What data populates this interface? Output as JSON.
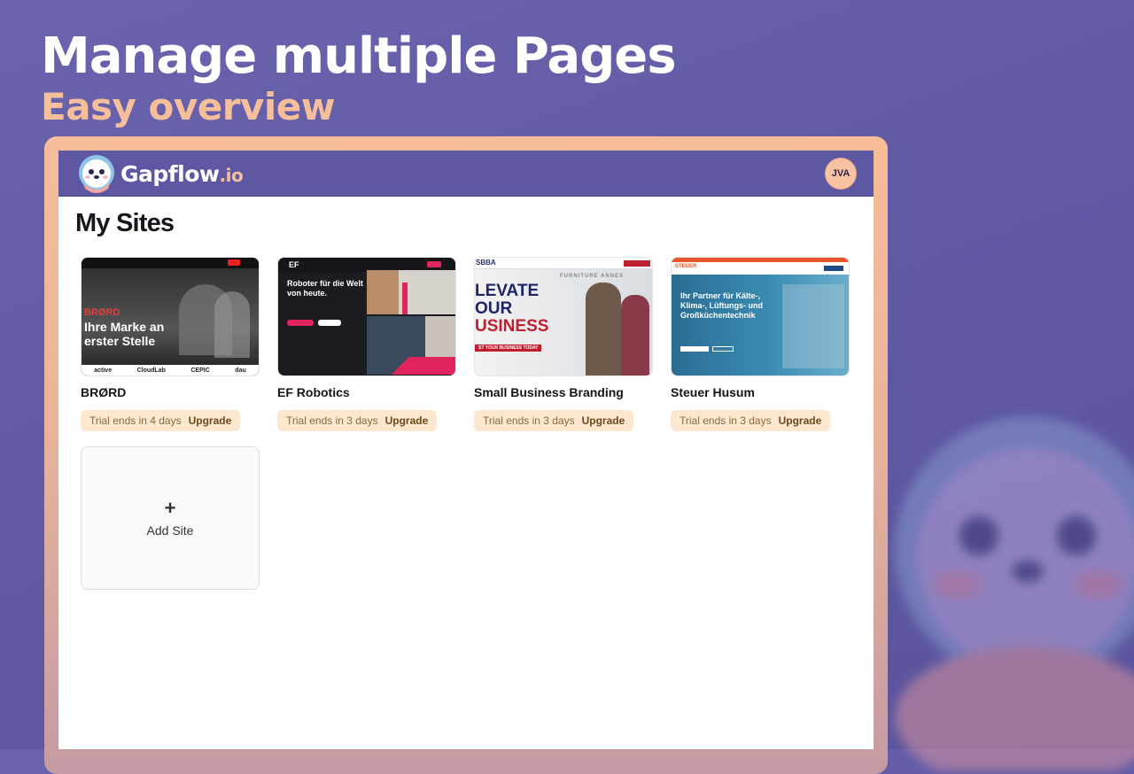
{
  "hero": {
    "title": "Manage multiple Pages",
    "subtitle": "Easy overview"
  },
  "app": {
    "brand": {
      "name": "Gapflow",
      "tld": ".io"
    },
    "user_initials": "JVA",
    "page_title": "My Sites",
    "sites": [
      {
        "name": "BRØRD",
        "trial": "Trial ends in 4 days",
        "action": "Upgrade",
        "thumb": {
          "headline_top": "BRØRD",
          "headline": "Ihre Marke an erster Stelle",
          "logos": [
            "active",
            "CloudLab",
            "CEPIC",
            "dau"
          ]
        }
      },
      {
        "name": "EF Robotics",
        "trial": "Trial ends in 3 days",
        "action": "Upgrade",
        "thumb": {
          "brand": "EF",
          "headline": "Roboter für die Welt von heute."
        }
      },
      {
        "name": "Small Business Branding",
        "trial": "Trial ends in 3 days",
        "action": "Upgrade",
        "thumb": {
          "brand": "SBBA",
          "headline_1": "LEVATE",
          "headline_2": "OUR",
          "headline_3": "USINESS",
          "banner": "ST YOUR BUSINESS TODAY",
          "sign": "FURNITURE ANNEX"
        }
      },
      {
        "name": "Steuer Husum",
        "trial": "Trial ends in 3 days",
        "action": "Upgrade",
        "thumb": {
          "brand": "STEUER",
          "headline": "Ihr Partner für Kälte-, Klima-, Lüftungs- und Großküchentechnik"
        }
      }
    ],
    "add_site": {
      "icon": "+",
      "label": "Add Site"
    }
  },
  "colors": {
    "accent": "#5e57a2",
    "peach": "#f5bf9c",
    "trial_bg": "#fde7cf"
  },
  "icons": {
    "logo": "mascot-icon",
    "add": "plus-icon"
  }
}
